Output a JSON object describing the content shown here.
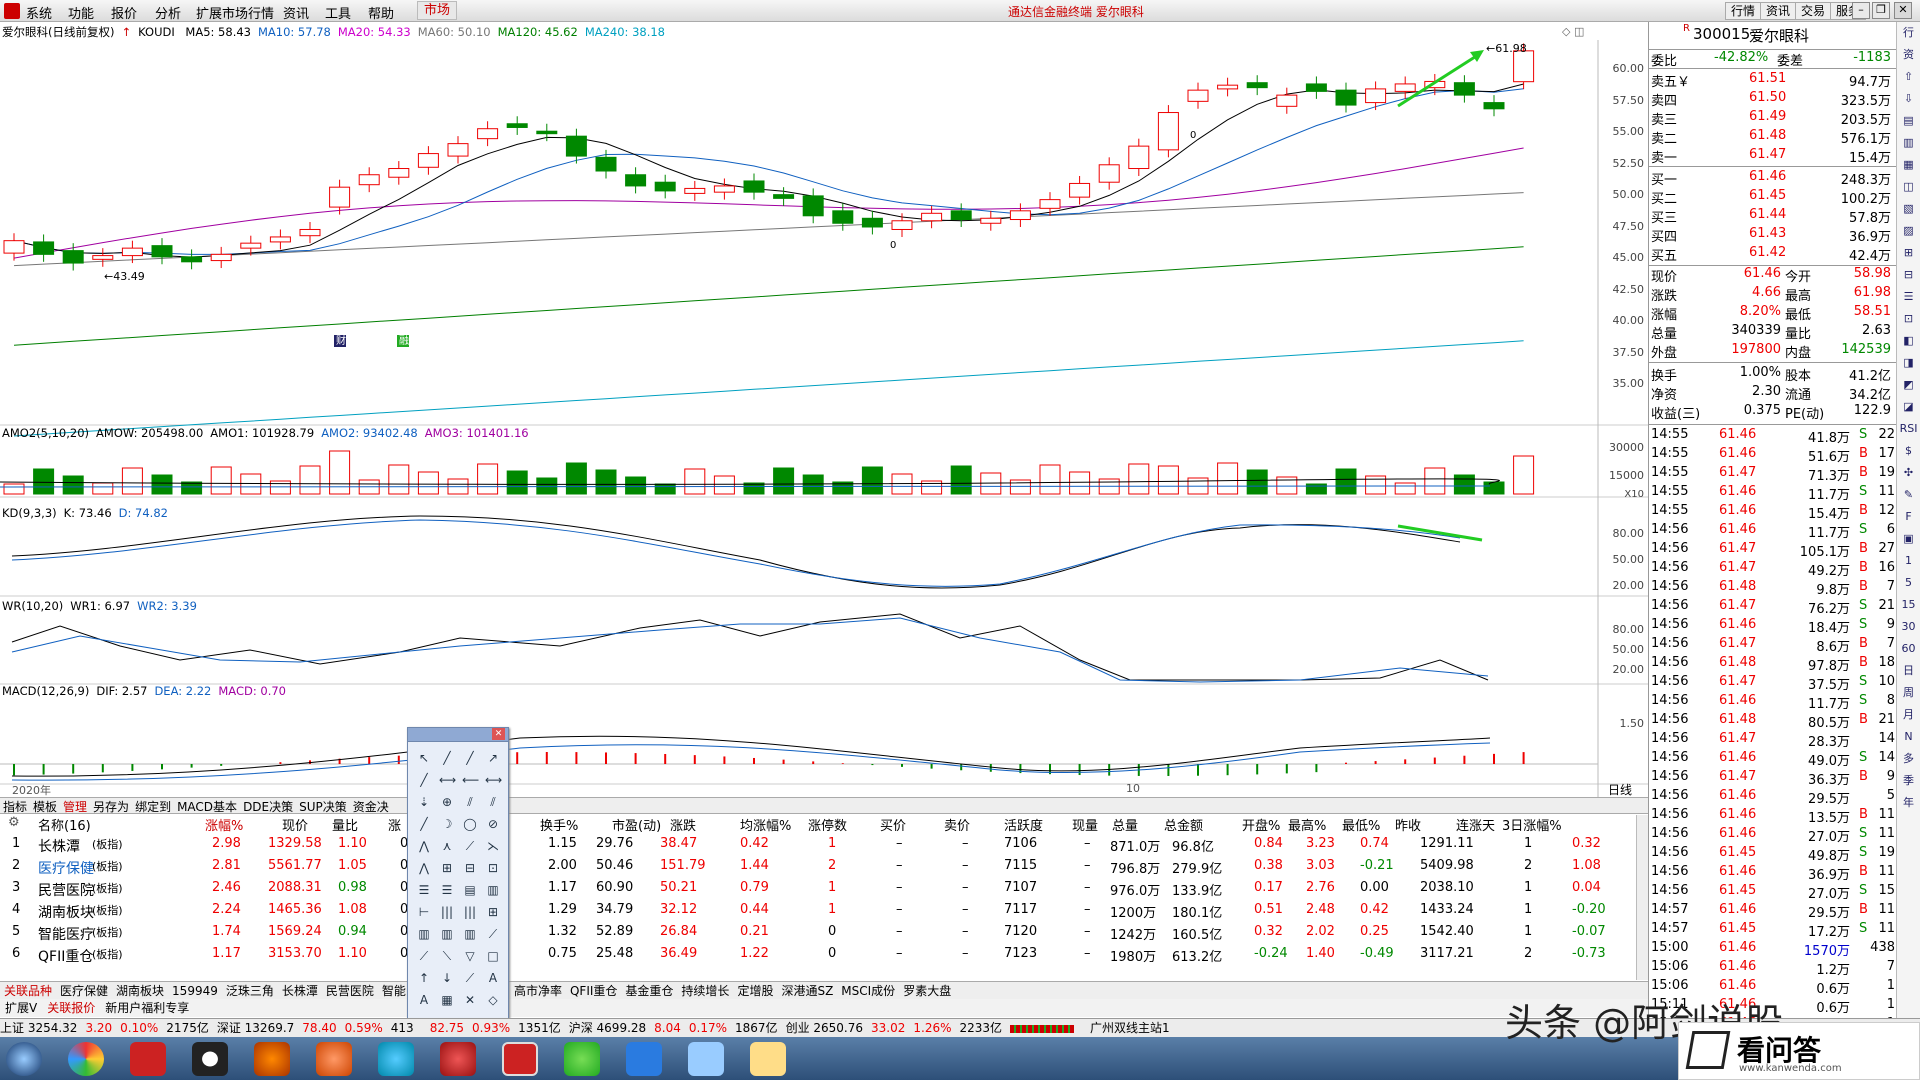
{
  "menu": {
    "items": [
      "系统",
      "功能",
      "报价",
      "分析",
      "扩展市场行情",
      "资讯",
      "工具",
      "帮助"
    ],
    "active": "市场",
    "app_title": "通达信金融终端 爱尔眼科",
    "right": [
      "行情",
      "资讯",
      "交易",
      "服务"
    ]
  },
  "chart": {
    "title": "爱尔眼科(日线前复权)",
    "indicator": "KOUDI",
    "ma": [
      {
        "label": "MA5: 58.43",
        "color": "#000000"
      },
      {
        "label": "MA10: 57.78",
        "color": "#1060c0"
      },
      {
        "label": "MA20: 54.33",
        "color": "#cc00cc"
      },
      {
        "label": "MA60: 50.10",
        "color": "#777777"
      },
      {
        "label": "MA120: 45.62",
        "color": "#007f00"
      },
      {
        "label": "MA240: 38.18",
        "color": "#00a0c0"
      }
    ],
    "yticks": [
      "60.00",
      "57.50",
      "55.00",
      "52.50",
      "50.00",
      "47.50",
      "45.00",
      "42.50",
      "40.00",
      "37.50",
      "35.00"
    ],
    "high_label": "61.98",
    "low_label": "43.49",
    "marker_0a": "0",
    "marker_0b": "0",
    "tag1": "财",
    "tag2": "融",
    "amo": {
      "label": "AMO2(5,10,20)",
      "amow": "AMOW: 205498.00",
      "amo1": "AMO1: 101928.79",
      "amo2": "AMO2: 93402.48",
      "amo3": "AMO3: 101401.16",
      "yticks": [
        "30000",
        "15000"
      ],
      "unit": "X10"
    },
    "kd": {
      "label": "KD(9,3,3)",
      "k": "K: 73.46",
      "d": "D: 74.82",
      "yticks": [
        "80.00",
        "50.00",
        "20.00"
      ]
    },
    "wr": {
      "label": "WR(10,20)",
      "wr1": "WR1: 6.97",
      "wr2": "WR2: 3.39",
      "yticks": [
        "80.00",
        "50.00",
        "20.00"
      ]
    },
    "macd": {
      "label": "MACD(12,26,9)",
      "dif": "DIF: 2.57",
      "dea": "DEA: 2.22",
      "macd": "MACD: 0.70",
      "ytick": "1.50"
    },
    "year": "2020年",
    "month": "10",
    "period": "日线"
  },
  "quote": {
    "code": "300015",
    "name": "爱尔眼科",
    "tag": "R",
    "wb_label": "委比",
    "wb": "-42.82%",
    "wc_label": "委差",
    "wc": "-1183",
    "sell": [
      {
        "l": "卖五￥",
        "p": "61.51",
        "v": "94.7万"
      },
      {
        "l": "卖四",
        "p": "61.50",
        "v": "323.5万"
      },
      {
        "l": "卖三",
        "p": "61.49",
        "v": "203.5万"
      },
      {
        "l": "卖二",
        "p": "61.48",
        "v": "576.1万"
      },
      {
        "l": "卖一",
        "p": "61.47",
        "v": "15.4万"
      }
    ],
    "buy": [
      {
        "l": "买一",
        "p": "61.46",
        "v": "248.3万"
      },
      {
        "l": "买二",
        "p": "61.45",
        "v": "100.2万"
      },
      {
        "l": "买三",
        "p": "61.44",
        "v": "57.8万"
      },
      {
        "l": "买四",
        "p": "61.43",
        "v": "36.9万"
      },
      {
        "l": "买五",
        "p": "61.42",
        "v": "42.4万"
      }
    ],
    "stats": [
      [
        "现价",
        "61.46",
        "今开",
        "58.98"
      ],
      [
        "涨跌",
        "4.66",
        "最高",
        "61.98"
      ],
      [
        "涨幅",
        "8.20%",
        "最低",
        "58.51"
      ],
      [
        "总量",
        "340339",
        "量比",
        "2.63"
      ],
      [
        "外盘",
        "197800",
        "内盘",
        "142539"
      ],
      [
        "换手",
        "1.00%",
        "股本",
        "41.2亿"
      ],
      [
        "净资",
        "2.30",
        "流通",
        "34.2亿"
      ],
      [
        "收益(三)",
        "0.375",
        "PE(动)",
        "122.9"
      ]
    ],
    "ticks": [
      [
        "14:55",
        "61.46",
        "41.8万",
        "S",
        "22"
      ],
      [
        "14:55",
        "61.46",
        "51.6万",
        "B",
        "17"
      ],
      [
        "14:55",
        "61.47",
        "71.3万",
        "B",
        "19"
      ],
      [
        "14:55",
        "61.46",
        "11.7万",
        "S",
        "11"
      ],
      [
        "14:55",
        "61.46",
        "15.4万",
        "B",
        "12"
      ],
      [
        "14:56",
        "61.46",
        "11.7万",
        "S",
        "6"
      ],
      [
        "14:56",
        "61.47",
        "105.1万",
        "B",
        "27"
      ],
      [
        "14:56",
        "61.47",
        "49.2万",
        "B",
        "16"
      ],
      [
        "14:56",
        "61.48",
        "9.8万",
        "B",
        "7"
      ],
      [
        "14:56",
        "61.47",
        "76.2万",
        "S",
        "21"
      ],
      [
        "14:56",
        "61.46",
        "18.4万",
        "S",
        "9"
      ],
      [
        "14:56",
        "61.47",
        "8.6万",
        "B",
        "7"
      ],
      [
        "14:56",
        "61.48",
        "97.8万",
        "B",
        "18"
      ],
      [
        "14:56",
        "61.47",
        "37.5万",
        "S",
        "10"
      ],
      [
        "14:56",
        "61.46",
        "11.7万",
        "S",
        "8"
      ],
      [
        "14:56",
        "61.48",
        "80.5万",
        "B",
        "21"
      ],
      [
        "14:56",
        "61.47",
        "28.3万",
        "",
        "14"
      ],
      [
        "14:56",
        "61.46",
        "49.0万",
        "S",
        "14"
      ],
      [
        "14:56",
        "61.47",
        "36.3万",
        "B",
        "9"
      ],
      [
        "14:56",
        "61.46",
        "29.5万",
        "",
        "5"
      ],
      [
        "14:56",
        "61.46",
        "13.5万",
        "B",
        "11"
      ],
      [
        "14:56",
        "61.46",
        "27.0万",
        "S",
        "11"
      ],
      [
        "14:56",
        "61.45",
        "49.8万",
        "S",
        "19"
      ],
      [
        "14:56",
        "61.46",
        "36.9万",
        "B",
        "11"
      ],
      [
        "14:56",
        "61.45",
        "27.0万",
        "S",
        "15"
      ],
      [
        "14:57",
        "61.46",
        "29.5万",
        "B",
        "11"
      ],
      [
        "14:57",
        "61.45",
        "17.2万",
        "S",
        "11"
      ],
      [
        "15:00",
        "61.46",
        "1570万",
        "",
        "438"
      ],
      [
        "15:06",
        "61.46",
        "1.2万",
        "",
        "7"
      ],
      [
        "15:06",
        "61.46",
        "0.6万",
        "",
        "1"
      ],
      [
        "15:11",
        "61.46",
        "0.6万",
        "",
        "1"
      ],
      [
        "15:19",
        "61.46",
        "0.6万",
        "",
        "1"
      ]
    ]
  },
  "right_strip": [
    "行",
    "资",
    "⇧",
    "⇩",
    "▤",
    "▥",
    "▦",
    "◫",
    "▧",
    "▨",
    "⊞",
    "⊟",
    "☰",
    "⊡",
    "◧",
    "◨",
    "◩",
    "◪",
    "RSI",
    "$",
    "✣",
    "✎",
    "F",
    "▣",
    "1",
    "5",
    "15",
    "30",
    "60",
    "日",
    "周",
    "月",
    "N",
    "多",
    "季",
    "年"
  ],
  "tabs1": [
    "指标",
    "模板",
    "管理",
    "另存为",
    "绑定到",
    "MACD基本",
    "DDE决策",
    "SUP决策",
    "资金决"
  ],
  "table": {
    "headers": [
      "名称(16)",
      "涨幅%",
      "现价",
      "量比",
      "涨",
      "换手%",
      "市盈(动)",
      "涨跌",
      "均涨幅%",
      "涨停数",
      "买价",
      "卖价",
      "活跃度",
      "现量",
      "总量",
      "总金额",
      "开盘%",
      "最高%",
      "最低%",
      "昨收",
      "连涨天",
      "3日涨幅%"
    ],
    "rows": [
      [
        "1",
        "长株潭",
        "(板指)",
        "2.98",
        "1329.58",
        "1.10",
        "0",
        "1.15",
        "29.76",
        "38.47",
        "0.42",
        "1",
        "–",
        "–",
        "7106",
        "–",
        "871.0万",
        "96.8亿",
        "0.84",
        "3.23",
        "0.74",
        "1291.11",
        "1",
        "0.32"
      ],
      [
        "2",
        "医疗保健",
        "(板指)",
        "2.81",
        "5561.77",
        "1.05",
        "0",
        "2.00",
        "50.46",
        "151.79",
        "1.44",
        "2",
        "–",
        "–",
        "7115",
        "–",
        "796.8万",
        "279.9亿",
        "0.38",
        "3.03",
        "-0.21",
        "5409.98",
        "2",
        "1.08"
      ],
      [
        "3",
        "民营医院",
        "(板指)",
        "2.46",
        "2088.31",
        "0.98",
        "0",
        "1.17",
        "60.90",
        "50.21",
        "0.79",
        "1",
        "–",
        "–",
        "7107",
        "–",
        "976.0万",
        "133.9亿",
        "0.17",
        "2.76",
        "0.00",
        "2038.10",
        "1",
        "0.04"
      ],
      [
        "4",
        "湖南板块",
        "(板指)",
        "2.24",
        "1465.36",
        "1.08",
        "0",
        "1.29",
        "34.79",
        "32.12",
        "0.44",
        "1",
        "–",
        "–",
        "7117",
        "–",
        "1200万",
        "180.1亿",
        "0.51",
        "2.48",
        "0.42",
        "1433.24",
        "1",
        "-0.20"
      ],
      [
        "5",
        "智能医疗",
        "(板指)",
        "1.74",
        "1569.24",
        "0.94",
        "0",
        "1.32",
        "52.89",
        "26.84",
        "0.21",
        "0",
        "–",
        "–",
        "7120",
        "–",
        "1242万",
        "160.5亿",
        "0.32",
        "2.02",
        "0.25",
        "1542.40",
        "1",
        "-0.07"
      ],
      [
        "6",
        "QFII重仓",
        "(板指)",
        "1.17",
        "3153.70",
        "1.10",
        "0",
        "0.75",
        "25.48",
        "36.49",
        "1.22",
        "0",
        "–",
        "–",
        "7123",
        "–",
        "1980万",
        "613.2亿",
        "-0.24",
        "1.40",
        "-0.49",
        "3117.21",
        "2",
        "-0.73"
      ]
    ]
  },
  "btabs": [
    "关联品种",
    "医疗保健",
    "湖南板块",
    "159949",
    "泛珠三角",
    "长株潭",
    "民营医院",
    "智能",
    "融资融券",
    "大盘股",
    "高市净率",
    "QFII重仓",
    "基金重仓",
    "持续增长",
    "定增股",
    "深港通SZ",
    "MSCI成份",
    "罗素大盘"
  ],
  "btabs2": [
    "扩展V",
    "关联报价",
    "新用户福利专享"
  ],
  "status": {
    "items": [
      "上证 3254.32",
      "3.20",
      "0.10%",
      "2175亿",
      "深证 13269.7",
      "78.40",
      "0.59%",
      "413",
      "",
      "82.75",
      "0.93%",
      "1351亿",
      "沪深 4699.28",
      "8.04",
      "0.17%",
      "1867亿",
      "创业 2650.76",
      "33.02",
      "1.26%",
      "2233亿"
    ],
    "broker": "广州双线主站1"
  },
  "watermark": "头条 @阿剑说股",
  "watermark2": "看问答",
  "watermark2_url": "www.kanwenda.com"
}
